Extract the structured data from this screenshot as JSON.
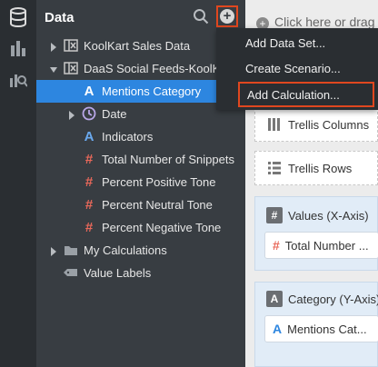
{
  "panel": {
    "title": "Data"
  },
  "tree": [
    {
      "label": "KoolKart Sales Data",
      "icon": "dataset-icon",
      "caret": "right"
    },
    {
      "label": "DaaS Social Feeds-KoolKart",
      "icon": "dataset-icon",
      "caret": "down"
    },
    {
      "label": "Mentions Category",
      "icon": "attribute-icon",
      "selected": true
    },
    {
      "label": "Date",
      "icon": "clock-icon",
      "caret": "right"
    },
    {
      "label": "Indicators",
      "icon": "attribute-icon"
    },
    {
      "label": "Total Number of Snippets",
      "icon": "measure-icon"
    },
    {
      "label": "Percent Positive Tone",
      "icon": "measure-icon"
    },
    {
      "label": "Percent Neutral Tone",
      "icon": "measure-icon"
    },
    {
      "label": "Percent Negative Tone",
      "icon": "measure-icon"
    },
    {
      "label": "My Calculations",
      "icon": "folder-icon",
      "caret": "right"
    },
    {
      "label": "Value Labels",
      "icon": "tag-icon"
    }
  ],
  "menu": {
    "items": [
      "Add Data Set...",
      "Create Scenario...",
      "Add Calculation..."
    ]
  },
  "canvas": {
    "drop_hint": "Click here or drag",
    "trellis_columns": "Trellis Columns",
    "trellis_rows": "Trellis Rows",
    "values_axis": "Values (X-Axis)",
    "values_chip": "Total Number ...",
    "category_axis": "Category (Y-Axis)",
    "category_chip": "Mentions Cat..."
  },
  "colors": {
    "accent": "#2d86e0",
    "highlight_border": "#e0471f",
    "measure": "#e8685a"
  }
}
